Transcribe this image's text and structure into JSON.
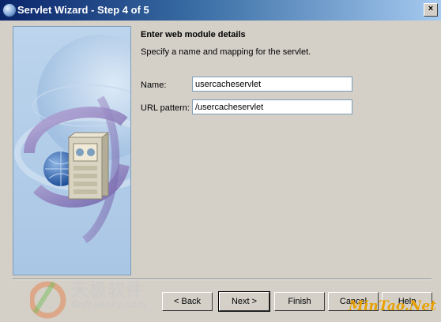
{
  "window": {
    "title": "Servlet Wizard - Step 4 of 5"
  },
  "content": {
    "heading": "Enter web module details",
    "subheading": "Specify a name and mapping for the servlet.",
    "fields": {
      "name_label": "Name:",
      "name_value": "usercacheservlet",
      "url_label": "URL pattern:",
      "url_value": "/usercacheservlet"
    }
  },
  "buttons": {
    "back": "< Back",
    "next": "Next >",
    "finish": "Finish",
    "cancel": "Cancel",
    "help": "Help"
  },
  "watermarks": {
    "left_cn": "天极软件",
    "left_en": "Soft.yesky.com",
    "right": "MinTao.Net"
  },
  "icons": {
    "title_icon": "wizard-app-icon",
    "close": "close-icon",
    "illustration": "server-globe-illustration"
  }
}
